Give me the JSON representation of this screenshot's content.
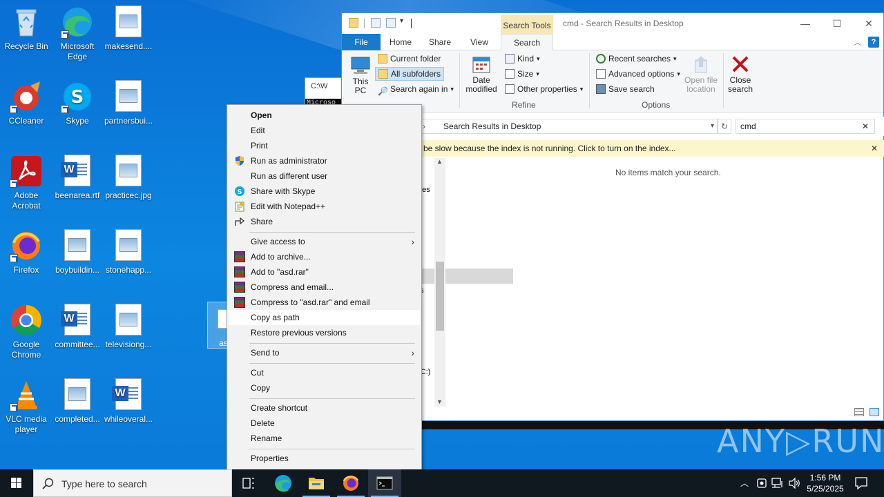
{
  "desktop": {
    "icons": [
      {
        "label": "Recycle Bin"
      },
      {
        "label": "Microsoft Edge"
      },
      {
        "label": "makesend...."
      },
      {
        "label": "CCleaner"
      },
      {
        "label": "Skype"
      },
      {
        "label": "partnersbui..."
      },
      {
        "label": "Adobe Acrobat"
      },
      {
        "label": "beenarea.rtf"
      },
      {
        "label": "practicec.jpg"
      },
      {
        "label": "Firefox"
      },
      {
        "label": "boybuildin..."
      },
      {
        "label": "stonehapp..."
      },
      {
        "label": "Google Chrome"
      },
      {
        "label": "committee..."
      },
      {
        "label": "televisiong..."
      },
      {
        "label": "VLC media player"
      },
      {
        "label": "completed..."
      },
      {
        "label": "whileoveral..."
      }
    ],
    "selected_file_label": "as",
    "watermark": "ANY▷RUN"
  },
  "cmd_window": {
    "title": "C:\\W",
    "body": "Microso"
  },
  "explorer": {
    "title": "cmd - Search Results in Desktop",
    "contextual_tab_group": "Search Tools",
    "tabs": [
      "File",
      "Home",
      "Share",
      "View",
      "Search"
    ],
    "ribbon": {
      "location": {
        "this_pc": "This PC",
        "current_folder": "Current folder",
        "all_subfolders": "All subfolders",
        "search_again_in": "Search again in"
      },
      "refine": {
        "label": "Refine",
        "date_modified": "Date modified",
        "kind": "Kind",
        "size": "Size",
        "other_properties": "Other properties"
      },
      "options": {
        "label": "Options",
        "recent_searches": "Recent searches",
        "advanced_options": "Advanced options",
        "save_search": "Save search",
        "open_file_location": "Open file location",
        "close_search": "Close search"
      }
    },
    "address": "Search Results in Desktop",
    "search_value": "cmd",
    "infobar": "be slow because the index is not running.  Click to turn on the index...",
    "nav_fragments": [
      "nes",
      "s",
      "ts",
      "s",
      "(C:)"
    ],
    "empty_message": "No items match your search."
  },
  "context_menu": {
    "items": [
      {
        "label": "Open",
        "bold": true
      },
      {
        "label": "Edit"
      },
      {
        "label": "Print"
      },
      {
        "label": "Run as administrator"
      },
      {
        "label": "Run as different user"
      },
      {
        "label": "Share with Skype"
      },
      {
        "label": "Edit with Notepad++"
      },
      {
        "label": "Share"
      },
      {
        "label": "Give access to"
      },
      {
        "label": "Add to archive..."
      },
      {
        "label": "Add to \"asd.rar\""
      },
      {
        "label": "Compress and email..."
      },
      {
        "label": "Compress to \"asd.rar\" and email"
      },
      {
        "label": "Copy as path"
      },
      {
        "label": "Restore previous versions"
      },
      {
        "label": "Send to"
      },
      {
        "label": "Cut"
      },
      {
        "label": "Copy"
      },
      {
        "label": "Create shortcut"
      },
      {
        "label": "Delete"
      },
      {
        "label": "Rename"
      },
      {
        "label": "Properties"
      }
    ],
    "highlighted": "Copy as path"
  },
  "taskbar": {
    "search_placeholder": "Type here to search",
    "time": "1:56 PM",
    "date": "5/25/2025"
  },
  "colors": {
    "accent": "#1979ca",
    "taskbar": "#101820",
    "infobar": "#fcf6cd",
    "search_tools": "#f6e7b6"
  }
}
